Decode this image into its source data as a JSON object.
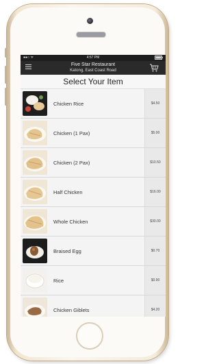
{
  "status": {
    "time": "4:57 PM"
  },
  "header": {
    "title": "Five Star Restaurant",
    "subtitle": "Katong, East Coast Road"
  },
  "page": {
    "title": "Select Your Item"
  },
  "items": [
    {
      "name": "Chicken Rice",
      "price": "$4.50",
      "thumb": "chicken-rice-icon"
    },
    {
      "name": "Chicken (1 Pax)",
      "price": "$5.00",
      "thumb": "chicken-plate-icon"
    },
    {
      "name": "Chicken (2 Pax)",
      "price": "$10.50",
      "thumb": "chicken-plate-icon"
    },
    {
      "name": "Half Chicken",
      "price": "$16.00",
      "thumb": "chicken-plate-icon"
    },
    {
      "name": "Whole Chicken",
      "price": "$30.00",
      "thumb": "chicken-plate-icon"
    },
    {
      "name": "Braised Egg",
      "price": "$0.70",
      "thumb": "braised-egg-icon"
    },
    {
      "name": "Rice",
      "price": "$0.90",
      "thumb": "rice-bowl-icon"
    },
    {
      "name": "Chicken Giblets",
      "price": "$4.20",
      "thumb": "chicken-giblets-icon"
    }
  ],
  "colors": {
    "header_bg": "#2a2a2a",
    "list_bg": "#f4f4f4",
    "price_bg": "#e9e9e9"
  }
}
